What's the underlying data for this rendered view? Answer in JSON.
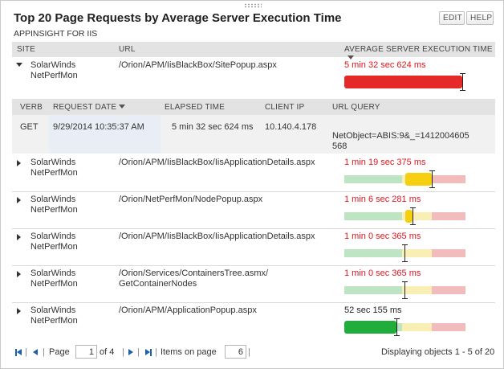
{
  "header": {
    "title": "Top 20 Page Requests by Average Server Execution Time",
    "subtitle": "APPINSIGHT FOR IIS",
    "edit_label": "EDIT",
    "help_label": "HELP"
  },
  "columns": {
    "site": "SITE",
    "url": "URL",
    "time": "AVERAGE SERVER EXECUTION TIME"
  },
  "rows": [
    {
      "site_line1": "SolarWinds",
      "site_line2": "NetPerfMon",
      "url_line1": "/Orion/APM/IisBlackBox/SitePopup.aspx",
      "url_line2": "",
      "time": "5 min 32 sec 624 ms",
      "status": "critical",
      "expanded": true,
      "gauge_level": 1.0
    },
    {
      "site_line1": "SolarWinds",
      "site_line2": "NetPerfMon",
      "url_line1": "/Orion/APM/IisBlackBox/IisApplicationDetails.aspx",
      "url_line2": "",
      "time": "1 min 19 sec 375 ms",
      "status": "critical",
      "expanded": false,
      "gauge_level": 0.74
    },
    {
      "site_line1": "SolarWinds",
      "site_line2": "NetPerfMon",
      "url_line1": "/Orion/NetPerfMon/NodePopup.aspx",
      "url_line2": "",
      "time": "1 min 6 sec 281 ms",
      "status": "critical",
      "expanded": false,
      "gauge_level": 0.58
    },
    {
      "site_line1": "SolarWinds",
      "site_line2": "NetPerfMon",
      "url_line1": "/Orion/APM/IisBlackBox/IisApplicationDetails.aspx",
      "url_line2": "",
      "time": "1 min 0 sec 365 ms",
      "status": "critical",
      "expanded": false,
      "gauge_level": 0.51
    },
    {
      "site_line1": "SolarWinds",
      "site_line2": "NetPerfMon",
      "url_line1": "/Orion/Services/ContainersTree.asmx/",
      "url_line2": "GetContainerNodes",
      "time": "1 min 0 sec 365 ms",
      "status": "critical",
      "expanded": false,
      "gauge_level": 0.51
    },
    {
      "site_line1": "SolarWinds",
      "site_line2": "NetPerfMon",
      "url_line1": "/Orion/APM/ApplicationPopup.aspx",
      "url_line2": "",
      "time": "52 sec 155 ms",
      "status": "ok",
      "expanded": false,
      "gauge_level": 0.44
    }
  ],
  "detail": {
    "headers": {
      "verb": "VERB",
      "request_date": "REQUEST DATE",
      "elapsed": "ELAPSED TIME",
      "client_ip": "CLIENT IP",
      "url_query": "URL QUERY"
    },
    "verb": "GET",
    "request_date": "9/29/2014 10:35:37 AM",
    "elapsed": "5 min 32 sec 624 ms",
    "client_ip": "10.140.4.178",
    "url_query_line1": "NetObject=ABIS:9&_=1412004605",
    "url_query_line2": "568"
  },
  "pager": {
    "page_label": "Page",
    "page_value": "1",
    "of_label": "of 4",
    "items_label": "Items on page",
    "items_value": "6",
    "displaying": "Displaying objects 1 - 5 of 20"
  },
  "colors": {
    "critical_text": "#e0141e",
    "gauge_red": "#e52828",
    "gauge_yellow": "#f5cf10",
    "gauge_green": "#1fae3a",
    "link_blue": "#1a5fa8"
  }
}
